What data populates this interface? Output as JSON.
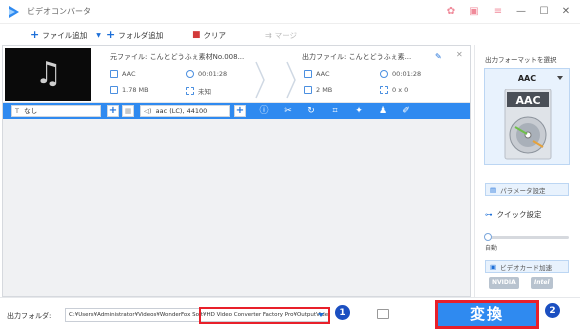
{
  "app": {
    "title": "ビデオコンバータ",
    "window_controls": {
      "minimize": "—",
      "maximize": "☐",
      "close": "✕"
    }
  },
  "toolbar": {
    "add_file_label": "ファイル追加",
    "add_folder_label": "フォルダ追加",
    "clear_label": "クリア",
    "merge_label": "マージ"
  },
  "file": {
    "source": {
      "title": "元ファイル: こんとどうふぇ素材No.008...",
      "format": "AAC",
      "duration": "00:01:28",
      "size": "1.78 MB",
      "resolution": "未知"
    },
    "output": {
      "title": "出力ファイル: こんとどうふぇ素...",
      "format": "AAC",
      "duration": "00:01:28",
      "size": "2 MB",
      "resolution": "0 x 0"
    }
  },
  "editbar": {
    "subtitle_value": "なし",
    "audio_value": "aac (LC), 44100"
  },
  "right_panel": {
    "output_format_label": "出力フォーマットを選択",
    "format_name": "AAC",
    "format_icon_text": "AAC",
    "param_settings_label": "パラメータ設定",
    "quick_settings_label": "クイック設定",
    "slider_value": 0,
    "auto_label": "自動",
    "gpu_accel_label": "ビデオカード加速",
    "vendor_nvidia": "NVIDIA",
    "vendor_intel": "Intel"
  },
  "bottom": {
    "output_folder_label": "出力フォルダ:",
    "output_path": "C:¥Users¥Administrator¥Videos¥WonderFox Soft¥HD Video Converter Factory Pro¥OutputVideo¥",
    "badge1": "1",
    "badge2": "2",
    "convert_label": "変換"
  },
  "colors": {
    "accent_blue": "#2f8af0",
    "highlight_red": "#e8202a",
    "badge_blue": "#1b4fc1"
  }
}
